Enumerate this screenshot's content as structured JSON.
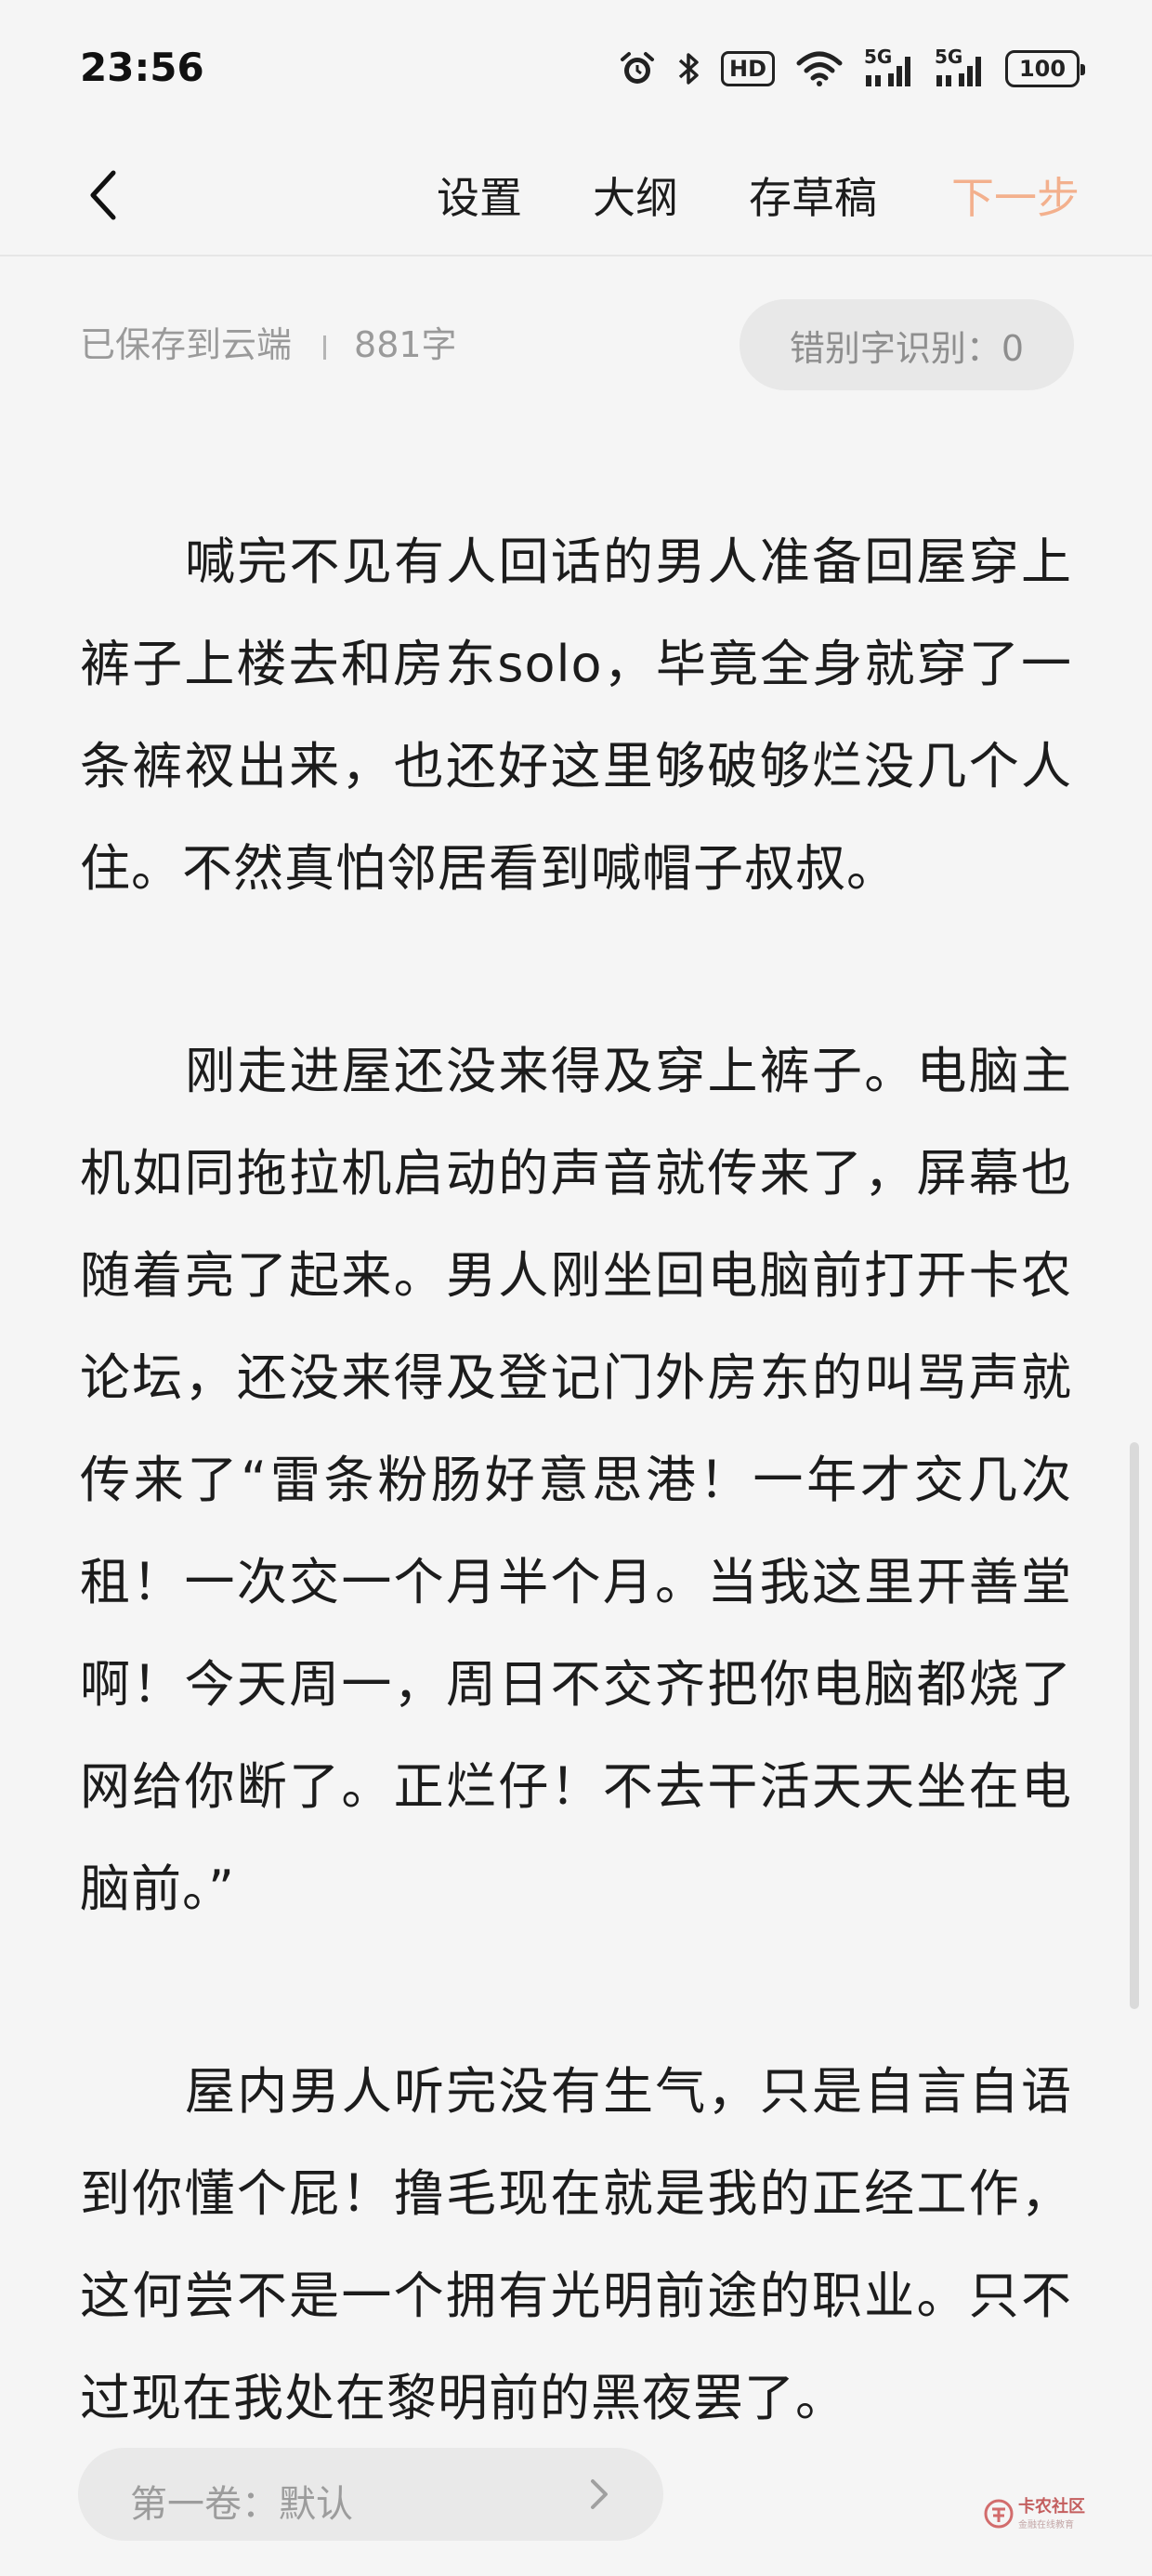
{
  "status_bar": {
    "time": "23:56",
    "network_label": "HD",
    "signal_1_label": "5G",
    "signal_2_label": "5G",
    "battery": "100",
    "icons": [
      "alarm-icon",
      "bluetooth-icon",
      "hd-icon",
      "wifi-icon",
      "signal-icon",
      "signal-icon",
      "battery-icon"
    ]
  },
  "nav": {
    "settings": "设置",
    "outline": "大纲",
    "save_draft": "存草稿",
    "next_step": "下一步",
    "next_color": "#f3b08d"
  },
  "info": {
    "save_status": "已保存到云端",
    "word_count": "881字",
    "typo_check": "错别字识别：0"
  },
  "content": {
    "paragraphs": [
      "喊完不见有人回话的男人准备回屋穿上裤子上楼去和房东solo，毕竟全身就穿了一条裤衩出来，也还好这里够破够烂没几个人住。不然真怕邻居看到喊帽子叔叔。",
      "刚走进屋还没来得及穿上裤子。电脑主机如同拖拉机启动的声音就传来了，屏幕也随着亮了起来。男人刚坐回电脑前打开卡农论坛，还没来得及登记门外房东的叫骂声就传来了“雷条粉肠好意思港！一年才交几次租！一次交一个月半个月。当我这里开善堂啊！今天周一，周日不交齐把你电脑都烧了网给你断了。正烂仔！不去干活天天坐在电脑前。”",
      "屋内男人听完没有生气，只是自言自语到你懂个屁！撸毛现在就是我的正经工作，这何尝不是一个拥有光明前途的职业。只不过现在我处在黎明前的黑夜罢了。"
    ]
  },
  "footer": {
    "volume": "第一卷：默认",
    "watermark_title": "卡农社区",
    "watermark_sub": "金融在线教育"
  }
}
